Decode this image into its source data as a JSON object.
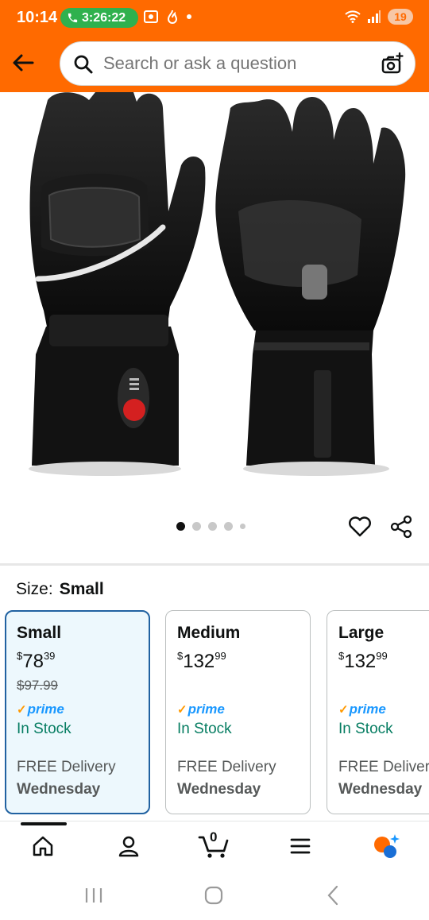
{
  "status_bar": {
    "time": "10:14",
    "call_timer": "3:26:22",
    "battery": "19"
  },
  "header": {
    "search_placeholder": "Search or ask a question"
  },
  "gallery": {
    "image_count": 5,
    "active_index": 0
  },
  "size": {
    "label": "Size:",
    "selected": "Small"
  },
  "size_options": [
    {
      "name": "Small",
      "currency": "$",
      "price_whole": "78",
      "price_fraction": "39",
      "list_price": "$97.99",
      "prime": "prime",
      "stock": "In Stock",
      "delivery": "FREE Delivery",
      "delivery_day": "Wednesday",
      "selected": true
    },
    {
      "name": "Medium",
      "currency": "$",
      "price_whole": "132",
      "price_fraction": "99",
      "list_price": "",
      "prime": "prime",
      "stock": "In Stock",
      "delivery": "FREE Delivery",
      "delivery_day": "Wednesday",
      "selected": false
    },
    {
      "name": "Large",
      "currency": "$",
      "price_whole": "132",
      "price_fraction": "99",
      "list_price": "",
      "prime": "prime",
      "stock": "In Stock",
      "delivery": "FREE Delivery",
      "delivery_day": "Wednesday",
      "selected": false
    }
  ],
  "bottom_nav": {
    "items": [
      "home-icon",
      "account-icon",
      "cart-icon",
      "menu-icon",
      "rufus-icon"
    ],
    "cart_count": "0"
  },
  "colors": {
    "brand": "#ff6a00",
    "selected_border": "#2162a1",
    "in_stock": "#067d62",
    "prime": "#1a98ff"
  }
}
